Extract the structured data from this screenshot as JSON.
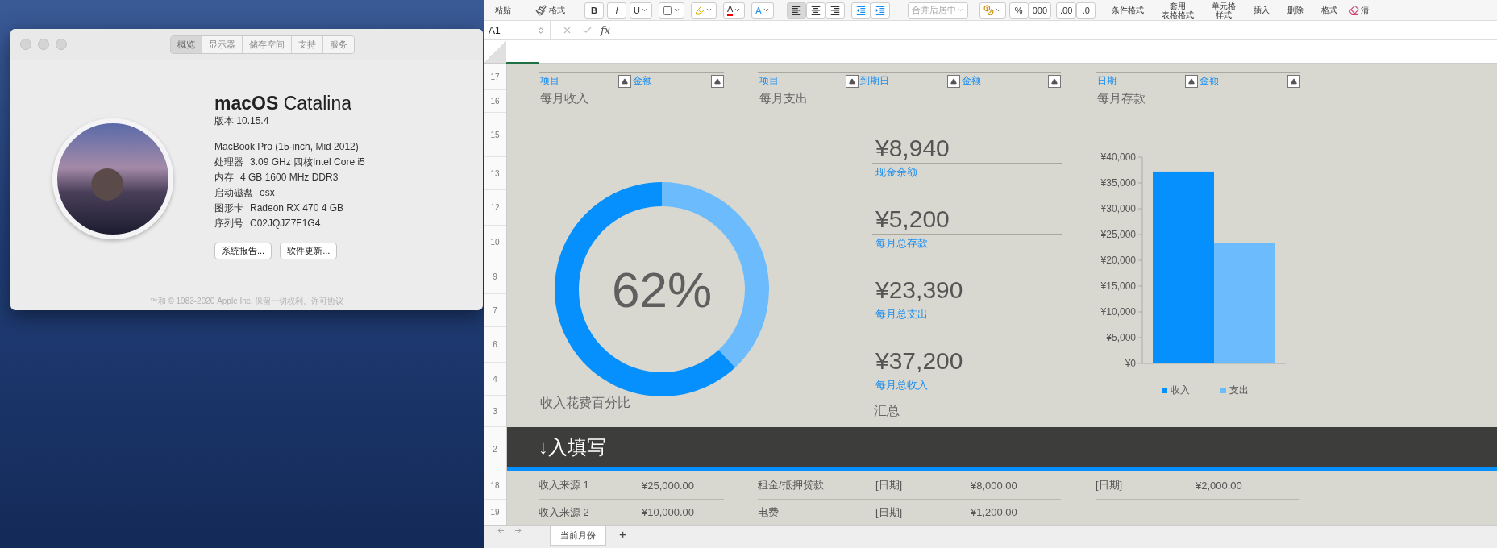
{
  "about_window": {
    "tabs": [
      {
        "label": "概览",
        "selected": true
      },
      {
        "label": "显示器",
        "selected": false
      },
      {
        "label": "储存空间",
        "selected": false
      },
      {
        "label": "支持",
        "selected": false
      },
      {
        "label": "服务",
        "selected": false
      }
    ],
    "title": "**macOS** Catalina",
    "version": "版本 10.15.4",
    "model": "MacBook Pro (15-inch, Mid 2012)",
    "specs": [
      {
        "label": "处理器",
        "value": "3.09 GHz 四核Intel Core i5"
      },
      {
        "label": "内存",
        "value": "4 GB 1600 MHz DDR3"
      },
      {
        "label": "启动磁盘",
        "value": "osx"
      },
      {
        "label": "图形卡",
        "value": "Radeon RX 470 4 GB"
      },
      {
        "label": "序列号",
        "value": "C02JQJZ7F1G4"
      }
    ],
    "buttons": [
      "系统报告...",
      "软件更新..."
    ],
    "footer": "™和 © 1983-2020 Apple Inc. 保留一切权利。许可协议"
  },
  "ribbon": {
    "paste": "粘贴",
    "format_painter": "格式",
    "bold": "B",
    "italic": "I",
    "underline": "U",
    "font_color": "A",
    "font_size": "A",
    "align": [
      {
        "selected": true
      },
      {
        "selected": false
      },
      {
        "selected": false
      }
    ],
    "merge": {
      "label": "合并后居中",
      "disabled": true
    },
    "percent": "%",
    "thousands": "000",
    "increase_decimal": ".00",
    "decrease_decimal": ".0",
    "commands": [
      [
        "条件格式"
      ],
      [
        "套用",
        "表格格式"
      ],
      [
        "单元格",
        "样式"
      ],
      [
        "插入"
      ],
      [
        "删除"
      ],
      [
        "格式"
      ]
    ],
    "clear": "清"
  },
  "formula_bar": {
    "cell": "A1",
    "fx": "fx"
  },
  "row_numbers": [
    "17",
    "16",
    "15",
    "13",
    "12",
    "10",
    "9",
    "7",
    "6",
    "4",
    "3",
    "2",
    "18",
    "19"
  ],
  "dashboard": {
    "tables": [
      {
        "columns": [
          "项目",
          "金额"
        ],
        "title": "每月收入"
      },
      {
        "columns": [
          "项目",
          "到期日",
          "金额"
        ],
        "title": "每月支出"
      },
      {
        "columns": [
          "日期",
          "金额"
        ],
        "title": "每月存款"
      }
    ],
    "donut": {
      "label": "62%",
      "caption": "收入花费百分比",
      "chart_data": {
        "type": "donut",
        "values": [
          62,
          38
        ]
      }
    },
    "summary": {
      "items": [
        {
          "value": "¥8,940",
          "label": "现金余额"
        },
        {
          "value": "¥5,200",
          "label": "每月总存款"
        },
        {
          "value": "¥23,390",
          "label": "每月总支出"
        },
        {
          "value": "¥37,200",
          "label": "每月总收入"
        }
      ],
      "caption": "汇总"
    },
    "bar_chart": {
      "chart_data": {
        "type": "bar",
        "ylim": [
          0,
          40000
        ],
        "yticks": [
          {
            "value": 0,
            "label": "¥0"
          },
          {
            "value": 5000,
            "label": "¥5,000"
          },
          {
            "value": 10000,
            "label": "¥10,000"
          },
          {
            "value": 15000,
            "label": "¥15,000"
          },
          {
            "value": 20000,
            "label": "¥20,000"
          },
          {
            "value": 25000,
            "label": "¥25,000"
          },
          {
            "value": 30000,
            "label": "¥30,000"
          },
          {
            "value": 35000,
            "label": "¥35,000"
          },
          {
            "value": 40000,
            "label": "¥40,000"
          }
        ],
        "series": [
          {
            "name": "收入",
            "color": "#0590fe",
            "values": [
              37200
            ]
          },
          {
            "name": "支出",
            "color": "#6bbbfd",
            "values": [
              23400
            ]
          }
        ]
      }
    }
  },
  "banner": "↓入填写",
  "rows": [
    [
      "收入来源 1",
      "¥25,000.00",
      "租金/抵押贷款",
      "[日期]",
      "¥8,000.00",
      "[日期]",
      "¥2,000.00"
    ],
    [
      "收入来源 2",
      "¥10,000.00",
      "电费",
      "[日期]",
      "¥1,200.00"
    ]
  ],
  "sheet_tabs": [
    {
      "label": "当前月份",
      "selected": true
    }
  ],
  "add_sheet": "+"
}
